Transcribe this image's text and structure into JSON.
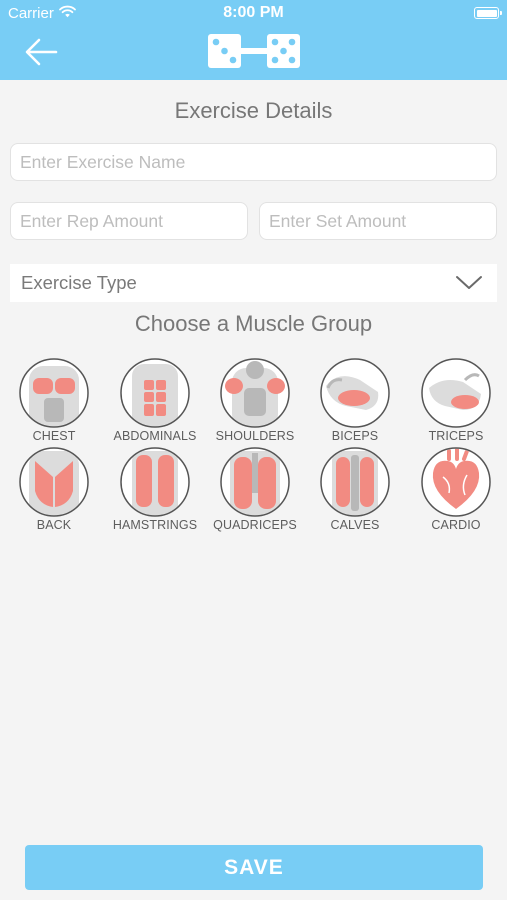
{
  "status_bar": {
    "carrier": "Carrier",
    "time": "8:00 PM",
    "icons": [
      "wifi-icon",
      "battery-icon"
    ]
  },
  "nav": {
    "back_icon": "arrow-left-icon",
    "logo_icon": "dumbbell-dice-logo"
  },
  "page_title": "Exercise Details",
  "form": {
    "exercise_name_placeholder": "Enter Exercise Name",
    "rep_placeholder": "Enter Rep Amount",
    "set_placeholder": "Enter Set Amount",
    "exercise_type_label": "Exercise Type",
    "exercise_type_icon": "chevron-down-icon"
  },
  "muscle_section_title": "Choose a Muscle Group",
  "muscle_groups": [
    {
      "label": "CHEST",
      "icon": "chest-icon"
    },
    {
      "label": "ABDOMINALS",
      "icon": "abdominals-icon"
    },
    {
      "label": "SHOULDERS",
      "icon": "shoulders-icon"
    },
    {
      "label": "BICEPS",
      "icon": "biceps-icon"
    },
    {
      "label": "TRICEPS",
      "icon": "triceps-icon"
    },
    {
      "label": "BACK",
      "icon": "back-icon"
    },
    {
      "label": "HAMSTRINGS",
      "icon": "hamstrings-icon"
    },
    {
      "label": "QUADRICEPS",
      "icon": "quadriceps-icon"
    },
    {
      "label": "CALVES",
      "icon": "calves-icon"
    },
    {
      "label": "CARDIO",
      "icon": "heart-icon"
    }
  ],
  "save_label": "SAVE",
  "colors": {
    "accent": "#78cdf5",
    "background": "#f4f4f4",
    "muscle_highlight": "#f28b82"
  }
}
